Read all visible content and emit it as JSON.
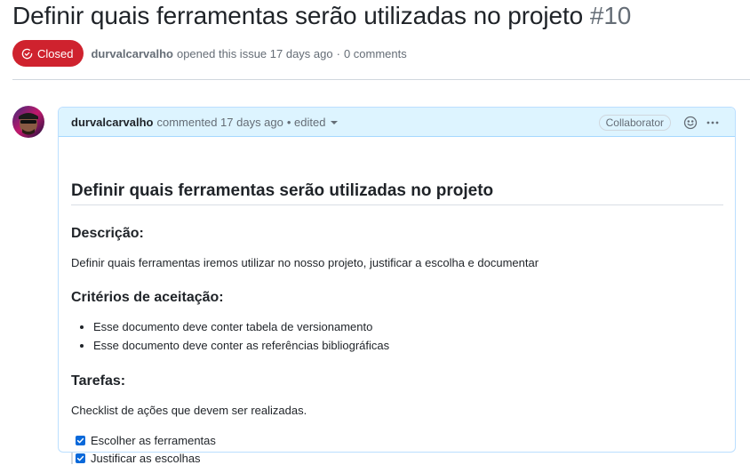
{
  "issue": {
    "title": "Definir quais ferramentas serão utilizadas no projeto",
    "number": "#10",
    "status": "Closed",
    "status_color": "#cf222e",
    "author": "durvalcarvalho",
    "opened_text": "opened this issue 17 days ago",
    "separator": "·",
    "comments_count": "0 comments"
  },
  "comment": {
    "author": "durvalcarvalho",
    "meta": "commented 17 days ago",
    "edited": "• edited",
    "role": "Collaborator",
    "icons": [
      "smiley-icon",
      "kebab-horizontal-icon",
      "caret-down-icon",
      "issue-closed-icon"
    ],
    "body": {
      "heading": "Definir quais ferramentas serão utilizadas no projeto",
      "description_heading": "Descrição:",
      "description": "Definir quais ferramentas iremos utilizar no nosso projeto, justificar a escolha e documentar",
      "criteria_heading": "Critérios de aceitação:",
      "criteria": [
        "Esse documento deve conter tabela de versionamento",
        "Esse documento deve conter as referências bibliográficas"
      ],
      "tasks_heading": "Tarefas:",
      "tasks_intro": "Checklist de ações que devem ser realizadas.",
      "tasks": [
        {
          "label": "Escolher as ferramentas",
          "checked": true
        },
        {
          "label": "Justificar as escolhas",
          "checked": true
        }
      ]
    }
  }
}
